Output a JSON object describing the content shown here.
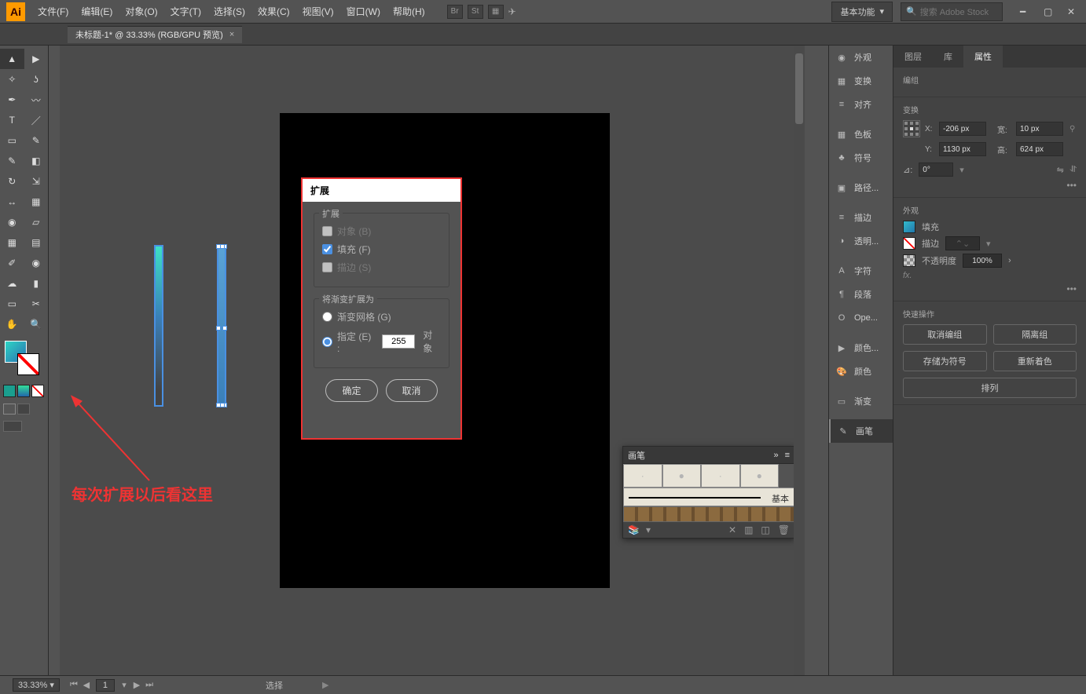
{
  "menubar": {
    "file": "文件(F)",
    "edit": "编辑(E)",
    "object": "对象(O)",
    "type": "文字(T)",
    "select": "选择(S)",
    "effect": "效果(C)",
    "view": "视图(V)",
    "window": "窗口(W)",
    "help": "帮助(H)"
  },
  "workspace_label": "基本功能",
  "search_placeholder": "搜索 Adobe Stock",
  "doc_tab": "未标题-1* @ 33.33% (RGB/GPU 预览)",
  "panel_strip": [
    {
      "id": "appearance",
      "icon": "◉",
      "label": "外观"
    },
    {
      "id": "transform",
      "icon": "▦",
      "label": "变换"
    },
    {
      "id": "align",
      "icon": "≡",
      "label": "对齐"
    },
    {
      "sep": true
    },
    {
      "id": "swatches",
      "icon": "▦",
      "label": "色板"
    },
    {
      "id": "symbols",
      "icon": "♣",
      "label": "符号"
    },
    {
      "sep": true
    },
    {
      "id": "pathfinder",
      "icon": "▣",
      "label": "路径..."
    },
    {
      "sep": true
    },
    {
      "id": "stroke",
      "icon": "≡",
      "label": "描边"
    },
    {
      "id": "transparency",
      "icon": "◑",
      "label": "透明..."
    },
    {
      "sep": true
    },
    {
      "id": "char",
      "icon": "A",
      "label": "字符"
    },
    {
      "id": "para",
      "icon": "¶",
      "label": "段落"
    },
    {
      "id": "opentype",
      "icon": "O",
      "label": "Ope..."
    },
    {
      "sep": true
    },
    {
      "id": "colorguide",
      "icon": "▶",
      "label": "颜色..."
    },
    {
      "id": "color",
      "icon": "🎨",
      "label": "颜色"
    },
    {
      "sep": true
    },
    {
      "id": "gradient",
      "icon": "▭",
      "label": "渐变"
    },
    {
      "sep": true
    },
    {
      "id": "brushes",
      "icon": "✎",
      "label": "画笔",
      "active": true
    }
  ],
  "prop": {
    "tabs": {
      "layers": "图层",
      "libraries": "库",
      "properties": "属性"
    },
    "group_title": "编组",
    "transform_title": "变换",
    "x_label": "X:",
    "x": "-206 px",
    "y_label": "Y:",
    "y": "1130 px",
    "w_label": "宽:",
    "w": "10 px",
    "h_label": "高:",
    "h": "624 px",
    "angle_label": "⊿:",
    "angle": "0°",
    "appearance_title": "外观",
    "fill_label": "填充",
    "stroke_label": "描边",
    "opacity_label": "不透明度",
    "opacity": "100%",
    "fx": "fx.",
    "quick_title": "快速操作",
    "qa": {
      "ungroup": "取消编组",
      "isolate": "隔离组",
      "save_symbol": "存储为符号",
      "recolor": "重新着色",
      "arrange": "排列"
    }
  },
  "dialog": {
    "title": "扩展",
    "fs1": "扩展",
    "obj": "对象 (B)",
    "fill": "填充 (F)",
    "stroke": "描边 (S)",
    "fs2": "将渐变扩展为",
    "mesh": "渐变网格 (G)",
    "specify": "指定 (E) :",
    "count": "255",
    "obj_suffix": "对象",
    "ok": "确定",
    "cancel": "取消"
  },
  "brush": {
    "title": "画笔",
    "basic": "基本"
  },
  "annotation_text": "每次扩展以后看这里",
  "status": {
    "zoom": "33.33%",
    "artboard": "1",
    "mode": "选择"
  }
}
